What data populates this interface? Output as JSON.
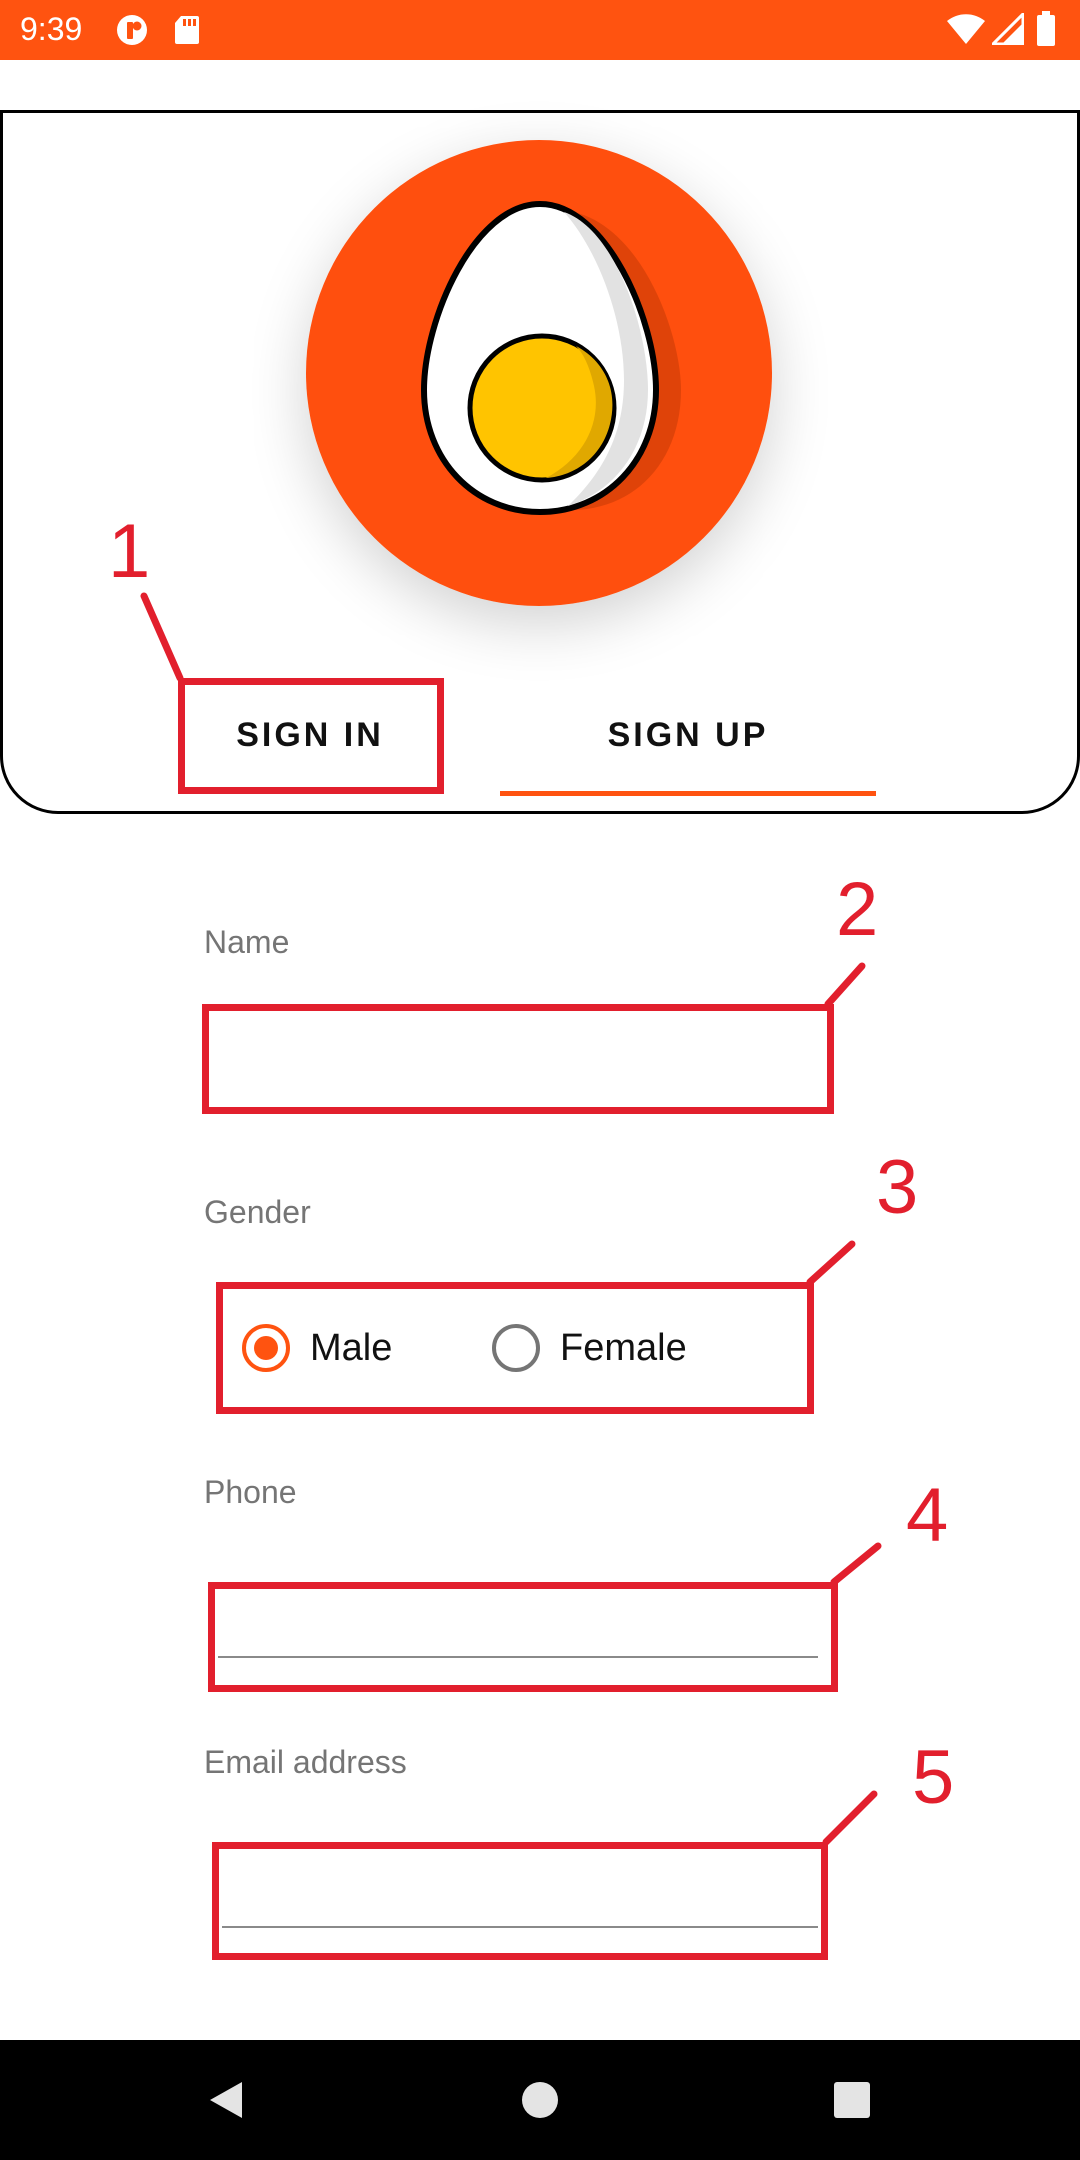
{
  "status_bar": {
    "time": "9:39",
    "background": "#ff5310",
    "icons": [
      "app-notification-icon",
      "sd-card-icon",
      "wifi-icon",
      "cell-signal-icon",
      "battery-icon"
    ]
  },
  "header": {
    "logo": "egg-logo-icon",
    "tabs": [
      {
        "label": "SIGN IN",
        "selected": false
      },
      {
        "label": "SIGN UP",
        "selected": true
      }
    ],
    "accent_color": "#ff5310"
  },
  "form": {
    "name": {
      "label": "Name",
      "value": "",
      "placeholder": ""
    },
    "gender": {
      "label": "Gender",
      "options": [
        {
          "label": "Male",
          "checked": true
        },
        {
          "label": "Female",
          "checked": false
        }
      ]
    },
    "phone": {
      "label": "Phone",
      "value": "",
      "placeholder": ""
    },
    "email": {
      "label": "Email address",
      "value": "",
      "placeholder": ""
    }
  },
  "annotations": {
    "color": "#e21f2d",
    "labels": [
      "1",
      "2",
      "3",
      "4",
      "5"
    ]
  },
  "nav_bar": {
    "buttons": [
      "back-icon",
      "home-icon",
      "recents-icon"
    ]
  }
}
